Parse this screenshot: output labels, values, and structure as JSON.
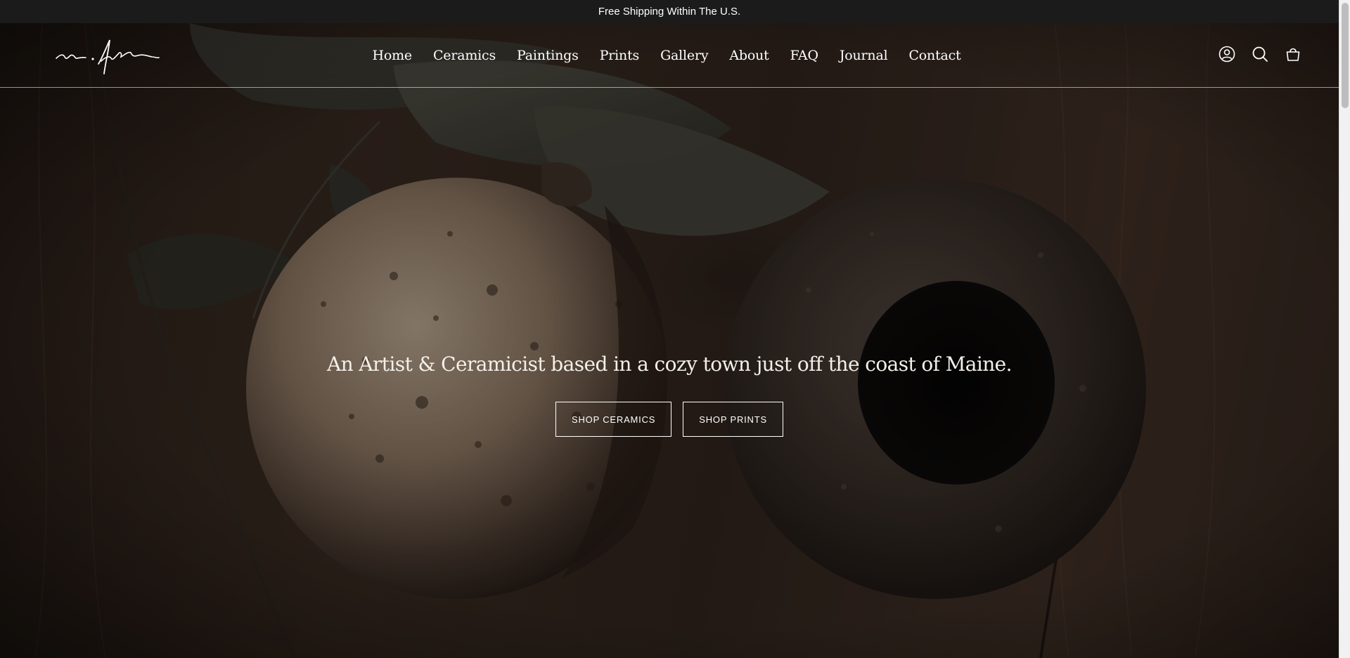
{
  "announcement": {
    "text": "Free Shipping Within The U.S."
  },
  "header": {
    "logo_name": "signature-logo",
    "nav": [
      {
        "label": "Home"
      },
      {
        "label": "Ceramics"
      },
      {
        "label": "Paintings"
      },
      {
        "label": "Prints"
      },
      {
        "label": "Gallery"
      },
      {
        "label": "About"
      },
      {
        "label": "FAQ"
      },
      {
        "label": "Journal"
      },
      {
        "label": "Contact"
      }
    ],
    "icons": [
      "account-icon",
      "search-icon",
      "cart-icon"
    ]
  },
  "hero": {
    "heading": "An Artist & Ceramicist based in a cozy town just off the coast of Maine.",
    "buttons": [
      {
        "label": "SHOP CERAMICS"
      },
      {
        "label": "SHOP PRINTS"
      }
    ]
  },
  "colors": {
    "announcement_bg": "#1b1b1b",
    "text": "#ffffff",
    "hero_bg": "#2f231c"
  }
}
